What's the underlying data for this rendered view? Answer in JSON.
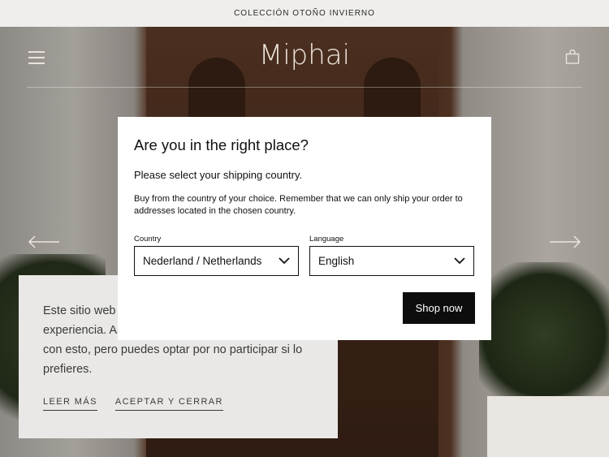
{
  "announcement": {
    "text": "COLECCIÓN OTOÑO INVIERNO"
  },
  "header": {
    "logo": "Miphai",
    "menu_icon": "hamburger-menu-icon",
    "cart_icon": "shopping-bag-icon"
  },
  "carousel": {
    "prev_icon": "arrow-left-icon",
    "next_icon": "arrow-right-icon"
  },
  "cookie_banner": {
    "text": "Este sitio web utiliza cookies para mejorar tu experiencia. Asumiremos que estás de acuerdo con esto, pero puedes optar por no participar si lo prefieres.",
    "read_more": "LEER MÁS",
    "accept": "ACEPTAR Y CERRAR"
  },
  "country_modal": {
    "title": "Are you in the right place?",
    "subtitle": "Please select your shipping country.",
    "description": "Buy from the country of your choice. Remember that we can only ship your order to addresses located in the chosen country.",
    "country_label": "Country",
    "country_value": "Nederland / Netherlands",
    "language_label": "Language",
    "language_value": "English",
    "shop_button": "Shop now"
  },
  "colors": {
    "button_bg": "#0d0d0d",
    "modal_bg": "#ffffff",
    "cookie_bg": "#e9e8e6",
    "announcement_bg": "#efeeec"
  }
}
